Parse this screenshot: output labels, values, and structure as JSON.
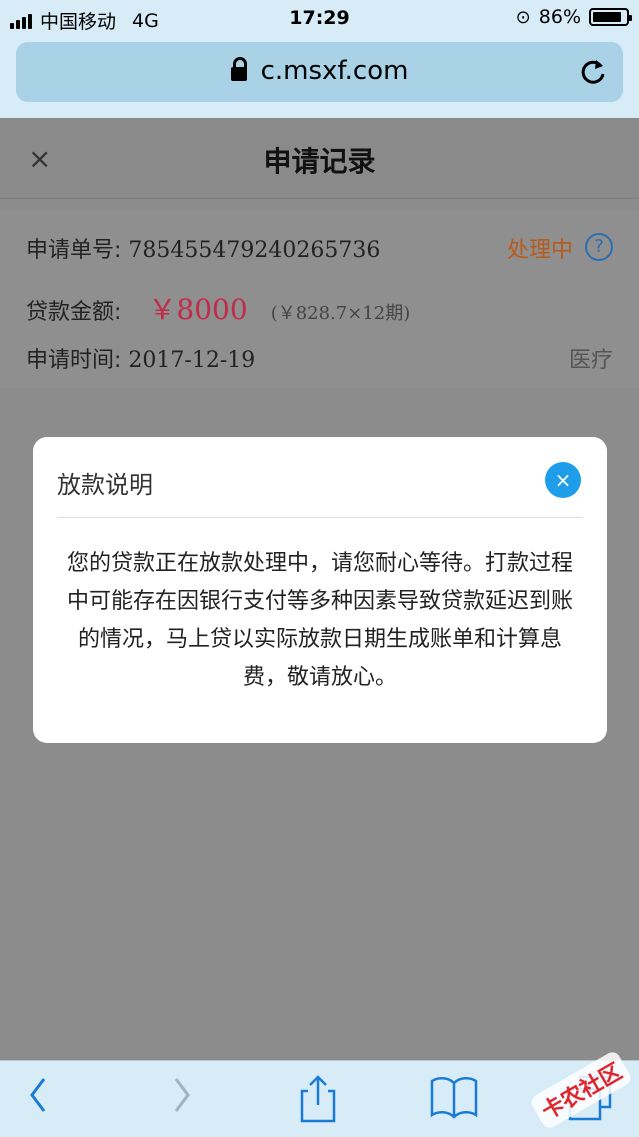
{
  "status_bar": {
    "carrier": "中国移动",
    "network": "4G",
    "time": "17:29",
    "battery": "86%",
    "battery_level": 0.86
  },
  "browser": {
    "url": "c.msxf.com"
  },
  "page": {
    "title": "申请记录",
    "record": {
      "order_label": "申请单号:",
      "order_number": "785455479240265736",
      "status": "处理中",
      "help_symbol": "?",
      "amount_label": "贷款金额:",
      "amount": "￥8000",
      "installment": "(￥828.7×12期)",
      "date_label": "申请时间:",
      "date": "2017-12-19",
      "category": "医疗"
    }
  },
  "modal": {
    "title": "放款说明",
    "close_symbol": "×",
    "body": "您的贷款正在放款处理中，请您耐心等待。打款过程中可能存在因银行支付等多种因素导致贷款延迟到账的情况，马上贷以实际放款日期生成账单和计算息费，敬请放心。"
  },
  "header": {
    "close_symbol": "×"
  },
  "watermark": "卡农社区",
  "colors": {
    "accent_blue": "#1e9ee8",
    "status_orange": "#b85a1a",
    "amount_red": "#c22a4a"
  }
}
